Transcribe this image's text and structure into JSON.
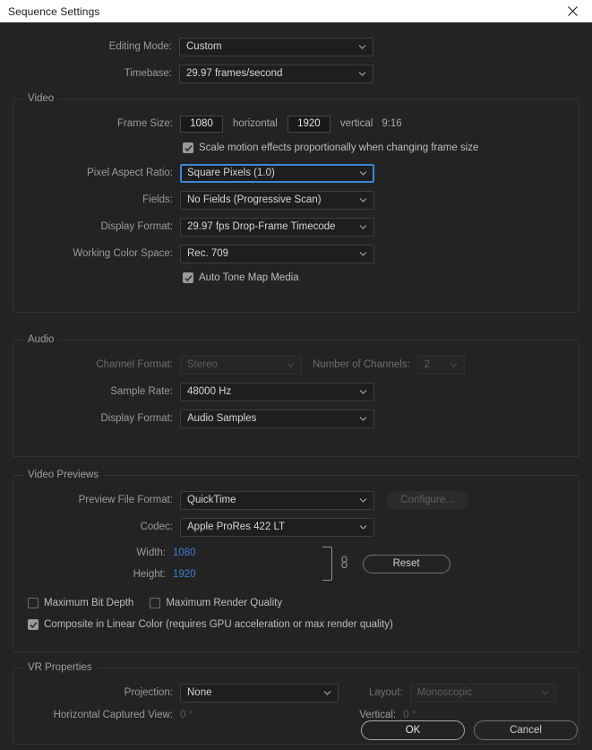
{
  "window": {
    "title": "Sequence Settings",
    "close_icon": "close-icon"
  },
  "top": {
    "editing_mode_label": "Editing Mode:",
    "editing_mode_value": "Custom",
    "timebase_label": "Timebase:",
    "timebase_value": "29.97  frames/second"
  },
  "video": {
    "legend": "Video",
    "frame_size_label": "Frame Size:",
    "frame_width": "1080",
    "horizontal_label": "horizontal",
    "frame_height": "1920",
    "vertical_label": "vertical",
    "aspect_ratio_text": "9:16",
    "scale_motion_label": "Scale motion effects proportionally when changing frame size",
    "scale_motion_checked": true,
    "pixel_aspect_label": "Pixel Aspect Ratio:",
    "pixel_aspect_value": "Square Pixels (1.0)",
    "fields_label": "Fields:",
    "fields_value": "No Fields (Progressive Scan)",
    "display_format_label": "Display Format:",
    "display_format_value": "29.97 fps Drop-Frame Timecode",
    "working_color_space_label": "Working Color Space:",
    "working_color_space_value": "Rec. 709",
    "auto_tone_map_label": "Auto Tone Map Media",
    "auto_tone_map_checked": true
  },
  "audio": {
    "legend": "Audio",
    "channel_format_label": "Channel Format:",
    "channel_format_value": "Stereo",
    "number_of_channels_label": "Number of Channels:",
    "number_of_channels_value": "2",
    "sample_rate_label": "Sample Rate:",
    "sample_rate_value": "48000 Hz",
    "display_format_label": "Display Format:",
    "display_format_value": "Audio Samples"
  },
  "video_previews": {
    "legend": "Video Previews",
    "preview_file_format_label": "Preview File Format:",
    "preview_file_format_value": "QuickTime",
    "configure_label": "Configure...",
    "codec_label": "Codec:",
    "codec_value": "Apple ProRes 422 LT",
    "width_label": "Width:",
    "width_value": "1080",
    "height_label": "Height:",
    "height_value": "1920",
    "reset_label": "Reset",
    "link_icon": "chain-link-icon",
    "max_bit_depth_label": "Maximum Bit Depth",
    "max_bit_depth_checked": false,
    "max_render_quality_label": "Maximum Render Quality",
    "max_render_quality_checked": false,
    "composite_linear_label": "Composite in Linear Color (requires GPU acceleration or max render quality)",
    "composite_linear_checked": true
  },
  "vr": {
    "legend": "VR Properties",
    "projection_label": "Projection:",
    "projection_value": "None",
    "layout_label": "Layout:",
    "layout_value": "Monoscopic",
    "horizontal_captured_view_label": "Horizontal Captured View:",
    "horizontal_captured_view_value": "0 °",
    "vertical_label": "Vertical:",
    "vertical_value": "0 °"
  },
  "footer": {
    "ok_label": "OK",
    "cancel_label": "Cancel"
  },
  "colors": {
    "accent_blue": "#3b7fd4",
    "focus_blue": "#3b86d6",
    "dialog_bg": "#232323",
    "titlebar_bg": "#ffffff"
  }
}
